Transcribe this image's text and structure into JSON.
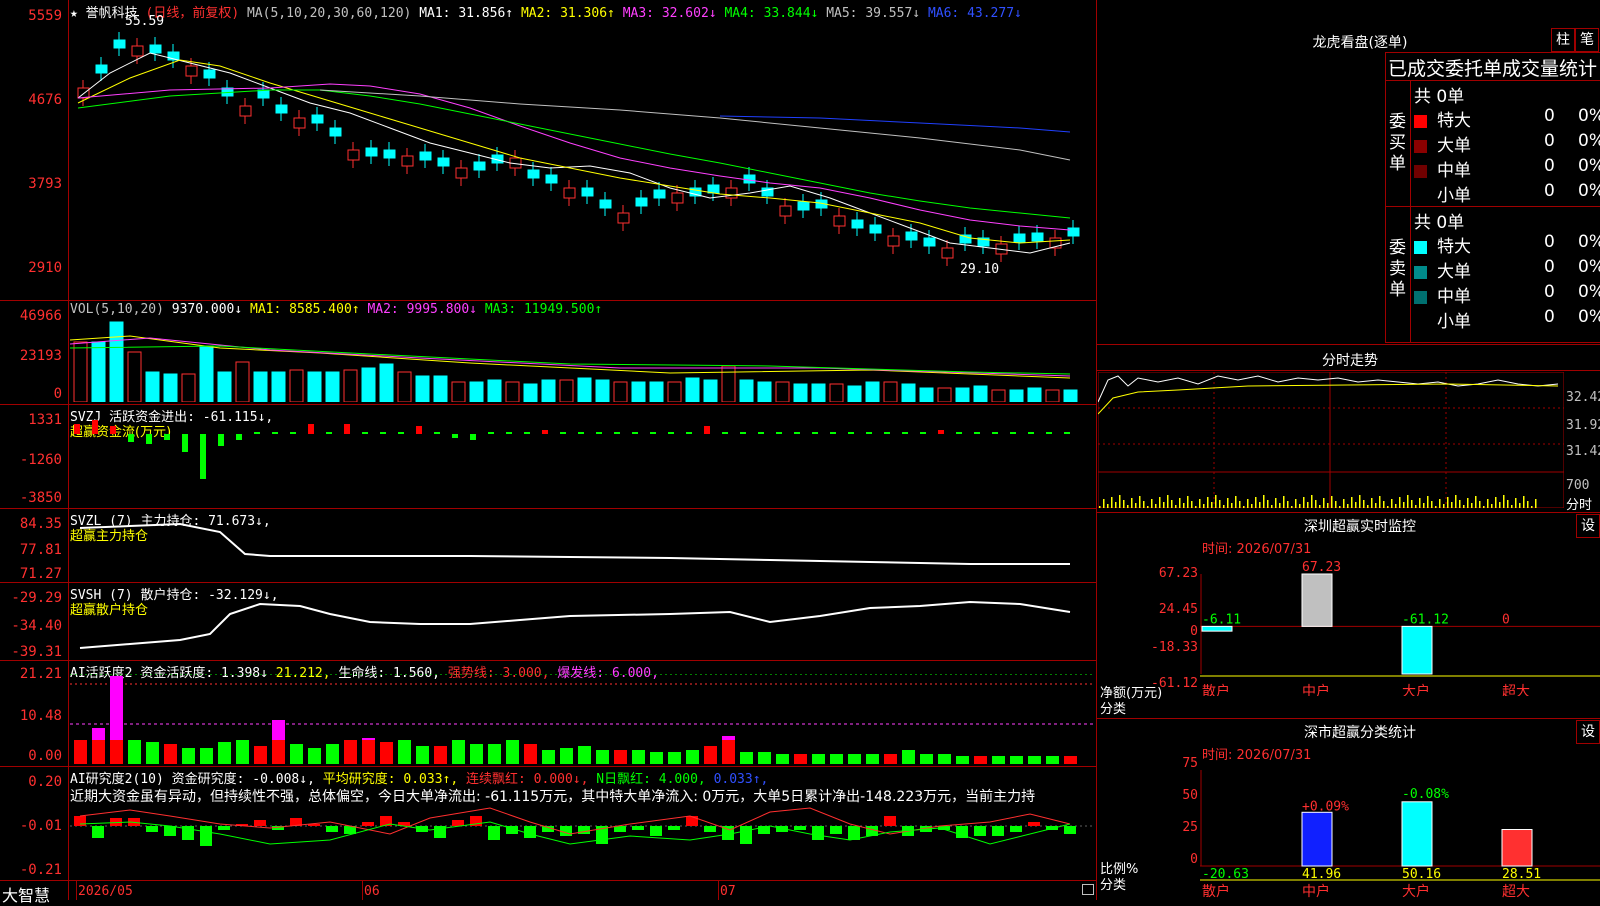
{
  "chart_header": {
    "star": "★",
    "stock_name": "誉帆科技",
    "period": "(日线，前复权)",
    "ma_prefix": "MA(5,10,20,30,60,120)",
    "ma1": "MA1: 31.856↑",
    "ma2": "MA2: 31.306↑",
    "ma3": "MA3: 32.602↓",
    "ma4": "MA4: 33.844↓",
    "ma5": "MA5: 39.557↓",
    "ma6": "MA6: 43.277↓"
  },
  "price_axis": [
    "5559",
    "4676",
    "3793",
    "2910"
  ],
  "price_annotations": {
    "high": "55.59",
    "low": "29.10"
  },
  "vol_header": {
    "name": "VOL(5,10,20)",
    "value": "9370.000↓",
    "ma1": "MA1: 8585.400↑",
    "ma2": "MA2: 9995.800↓",
    "ma3": "MA3: 11949.500↑"
  },
  "vol_axis": [
    "46966",
    "23193",
    "0"
  ],
  "svzj": {
    "header": "SVZJ  活跃资金进出: -61.115↓,",
    "sub": "超赢资金流(万元)",
    "axis": [
      "1331",
      "-1260",
      "-3850"
    ]
  },
  "svzl": {
    "header": "SVZL (7) 主力持仓: 71.673↓,",
    "sub": "超赢主力持仓",
    "axis": [
      "84.35",
      "77.81",
      "71.27"
    ]
  },
  "svsh": {
    "header": "SVSH (7) 散户持仓: -32.129↓,",
    "sub": "超赢散户持仓",
    "axis": [
      "-29.29",
      "-34.40",
      "-39.31"
    ]
  },
  "ai_active": {
    "name": "AI活跃度2",
    "a": "资金活跃度: 1.398↓",
    "b": "21.212,",
    "c": "生命线: 1.560,",
    "d": "强势线: 3.000,",
    "e": "爆发线: 6.000,",
    "axis": [
      "21.21",
      "10.48",
      "0.00"
    ]
  },
  "ai_research": {
    "name": "AI研究度2(10)",
    "a": "资金研究度: -0.008↓,",
    "b": "平均研究度: 0.033↑,",
    "c": "连续飘红: 0.000↓,",
    "d": "N日飘红: 4.000,",
    "e": "0.033↑,",
    "desc": "近期大资金虽有异动，但持续性不强，总体偏空，今日大单净流出: -61.115万元，其中特大单净流入: 0万元，大单5日累计净出-148.223万元，当前主力持",
    "axis": [
      "0.20",
      "-0.01",
      "-0.21"
    ]
  },
  "bottom": {
    "app": "大智慧",
    "dates": [
      "2026/05",
      "06",
      "07"
    ]
  },
  "lhb": {
    "title": "龙虎看盘(逐单)",
    "btn1": "柱",
    "btn2": "笔",
    "subtitle": "已成交委托单成交量统计",
    "buy_total": "共 0单",
    "sell_total": "共 0单",
    "buy_label": "委买单",
    "sell_label": "委卖单",
    "buy_rows": [
      {
        "name": "特大",
        "count": "0",
        "pct": "0%",
        "color": "#ff0000"
      },
      {
        "name": "大单",
        "count": "0",
        "pct": "0%",
        "color": "#8b0000"
      },
      {
        "name": "中单",
        "count": "0",
        "pct": "0%",
        "color": "#700000"
      },
      {
        "name": "小单",
        "count": "0",
        "pct": "0%",
        "color": "#000000"
      }
    ],
    "sell_rows": [
      {
        "name": "特大",
        "count": "0",
        "pct": "0%",
        "color": "#00ffff"
      },
      {
        "name": "大单",
        "count": "0",
        "pct": "0%",
        "color": "#008b8b"
      },
      {
        "name": "中单",
        "count": "0",
        "pct": "0%",
        "color": "#007070"
      },
      {
        "name": "小单",
        "count": "0",
        "pct": "0%",
        "color": "#000000"
      }
    ]
  },
  "intraday": {
    "title": "分时走势",
    "axis": [
      "32.42",
      "31.92",
      "31.42",
      "700"
    ],
    "unit": "分时"
  },
  "sz_monitor": {
    "title": "深圳超赢实时监控",
    "btn": "设",
    "time": "时间: 2026/07/31",
    "axis": [
      "67.23",
      "24.45",
      "0",
      "-18.33",
      "-61.12"
    ],
    "ylabel": "净额(万元)",
    "xlabel": "分类",
    "values": [
      "-6.11",
      "67.23",
      "-61.12",
      "0"
    ],
    "categories": [
      "散户",
      "中户",
      "大户",
      "超大"
    ]
  },
  "sz_stats": {
    "title": "深市超赢分类统计",
    "btn": "设",
    "time": "时间: 2026/07/31",
    "axis": [
      "75",
      "50",
      "25",
      "0"
    ],
    "ylabel": "比例%",
    "xlabel": "分类",
    "changes": [
      "+0.09%",
      "-0.08%"
    ],
    "values": [
      "-20.63",
      "41.96",
      "50.16",
      "28.51"
    ],
    "categories": [
      "散户",
      "中户",
      "大户",
      "超大"
    ]
  },
  "chart_data": [
    {
      "type": "bar",
      "title": "深圳超赢实时监控",
      "categories": [
        "散户",
        "中户",
        "大户",
        "超大"
      ],
      "values": [
        -6.11,
        67.23,
        -61.12,
        0
      ],
      "ylabel": "净额(万元)",
      "ylim": [
        -61.12,
        67.23
      ]
    },
    {
      "type": "bar",
      "title": "深市超赢分类统计",
      "categories": [
        "散户",
        "中户",
        "大户",
        "超大"
      ],
      "values": [
        -20.63,
        41.96,
        50.16,
        28.51
      ],
      "ylabel": "比例%",
      "ylim": [
        0,
        75
      ]
    }
  ],
  "colors": {
    "up": "#ff3030",
    "down": "#00ffff",
    "frame": "#a00000"
  }
}
